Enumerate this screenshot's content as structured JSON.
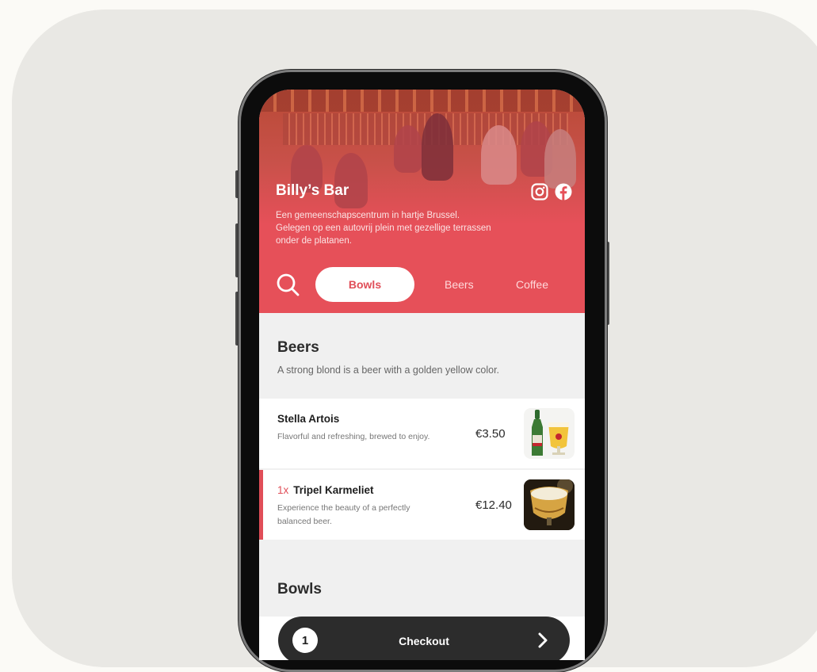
{
  "venue": {
    "name": "Billy’s Bar",
    "description_lines": [
      "Een gemeenschapscentrum in hartje Brussel.",
      "Gelegen op een autovrij plein met gezellige terrassen",
      "onder de platanen."
    ]
  },
  "social_icons": [
    "instagram-icon",
    "facebook-icon"
  ],
  "tabs": {
    "active": "Bowls",
    "others": [
      "Beers",
      "Coffee"
    ]
  },
  "sections": [
    {
      "title": "Beers",
      "description": "A strong blond is a beer with a golden yellow color.",
      "items": [
        {
          "name": "Stella Artois",
          "quantity": "",
          "description": "Flavorful and refreshing, brewed to enjoy.",
          "price": "€3.50",
          "in_cart": false
        },
        {
          "name": "Tripel Karmeliet",
          "quantity": "1x",
          "description": "Experience the beauty of a perfectly balanced beer.",
          "price": "€12.40",
          "in_cart": true
        }
      ]
    },
    {
      "title": "Bowls"
    }
  ],
  "checkout": {
    "count": "1",
    "label": "Checkout"
  },
  "colors": {
    "accent": "#e04e58",
    "hero": "#e65059",
    "checkout_bg": "#2c2c2c",
    "background": "#e9e8e4"
  }
}
